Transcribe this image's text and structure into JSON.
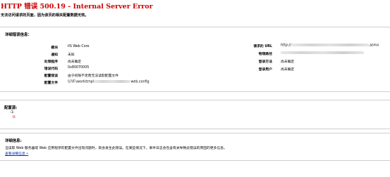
{
  "error": {
    "title": "HTTP 错误 500.19 - Internal Server Error",
    "subtitle": "无法访问请求的页面，因为该页的相关配置数据无效。"
  },
  "details": {
    "heading": "详细错误信息：",
    "left": [
      {
        "label": "模块",
        "value": "IIS Web Core"
      },
      {
        "label": "通知",
        "value": "未知"
      },
      {
        "label": "处理程序",
        "value": "尚未确定"
      },
      {
        "label": "错误代码",
        "value": "0x80070005"
      },
      {
        "label": "配置错误",
        "value": "由于权限不足而无法读取配置文件"
      },
      {
        "label": "配置文件",
        "value_prefix": "\\\\?\\F:\\work\\tmp\\",
        "value_suffix": "web.config"
      }
    ],
    "right": [
      {
        "label": "请求的 URL",
        "value_prefix": "http://",
        "value_suffix": ".asmx"
      },
      {
        "label": "物理路径",
        "value": ""
      },
      {
        "label": "登录方法",
        "value": "尚未确定"
      },
      {
        "label": "登录用户",
        "value": "尚未确定"
      }
    ]
  },
  "config_source": {
    "heading": "配置源:",
    "line1": "-1:",
    "line2": "0:"
  },
  "more_info": {
    "heading": "详细信息:",
    "text": "当读取 Web 服务器或 Web 应用程序的配置文件出现问题时，就会发生此错误。在某些情况下，事件日志会包含有关导致此错误的原因的更多信息。",
    "link": "查看详细信息 »"
  }
}
